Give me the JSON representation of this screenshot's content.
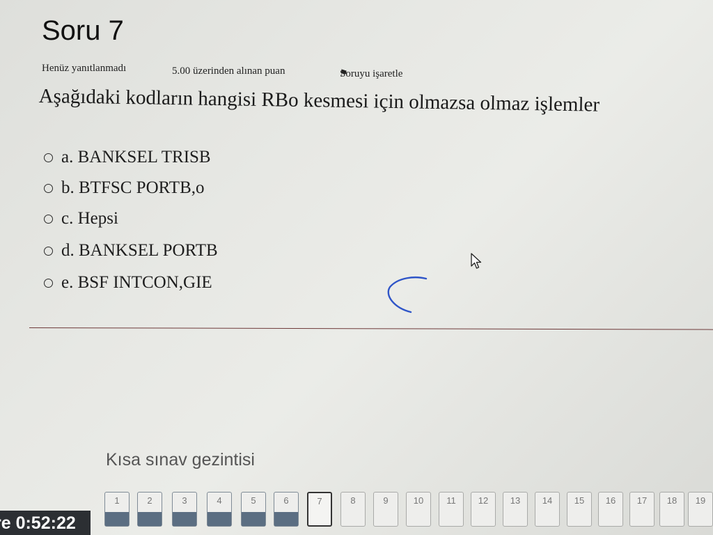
{
  "question": {
    "title": "Soru 7",
    "status": "Henüz yanıtlanmadı",
    "grade": "5.00 üzerinden alınan puan",
    "flag_label": "Soruyu işaretle",
    "text": "Aşağıdaki kodların hangisi RBo kesmesi için olmazsa olmaz işlemler",
    "options": [
      {
        "label": "a. BANKSEL TRISB"
      },
      {
        "label": "b. BTFSC PORTB,o"
      },
      {
        "label": "c. Hepsi"
      },
      {
        "label": "d. BANKSEL PORTB"
      },
      {
        "label": "e. BSF INTCON,GIE"
      }
    ]
  },
  "navigation": {
    "title": "Kısa sınav gezintisi",
    "questions": [
      {
        "num": "1",
        "state": "answered"
      },
      {
        "num": "2",
        "state": "answered"
      },
      {
        "num": "3",
        "state": "answered"
      },
      {
        "num": "4",
        "state": "answered"
      },
      {
        "num": "5",
        "state": "answered"
      },
      {
        "num": "6",
        "state": "answered"
      },
      {
        "num": "7",
        "state": "current"
      },
      {
        "num": "8",
        "state": "empty"
      },
      {
        "num": "9",
        "state": "empty"
      },
      {
        "num": "10",
        "state": "empty"
      },
      {
        "num": "11",
        "state": "empty"
      },
      {
        "num": "12",
        "state": "empty"
      },
      {
        "num": "13",
        "state": "empty"
      },
      {
        "num": "14",
        "state": "empty"
      },
      {
        "num": "15",
        "state": "empty"
      },
      {
        "num": "16",
        "state": "empty"
      },
      {
        "num": "17",
        "state": "empty"
      },
      {
        "num": "18",
        "state": "empty"
      },
      {
        "num": "19",
        "state": "empty"
      }
    ]
  },
  "timer": {
    "text": "re 0:52:22"
  },
  "colors": {
    "answered_fill": "#5b6e82",
    "divider": "#6e3a3a",
    "pen_mark": "#2f55c8",
    "timer_bg": "#2c2f33"
  },
  "icons": {
    "flag": "flag-icon",
    "cursor": "mouse-pointer-icon"
  }
}
